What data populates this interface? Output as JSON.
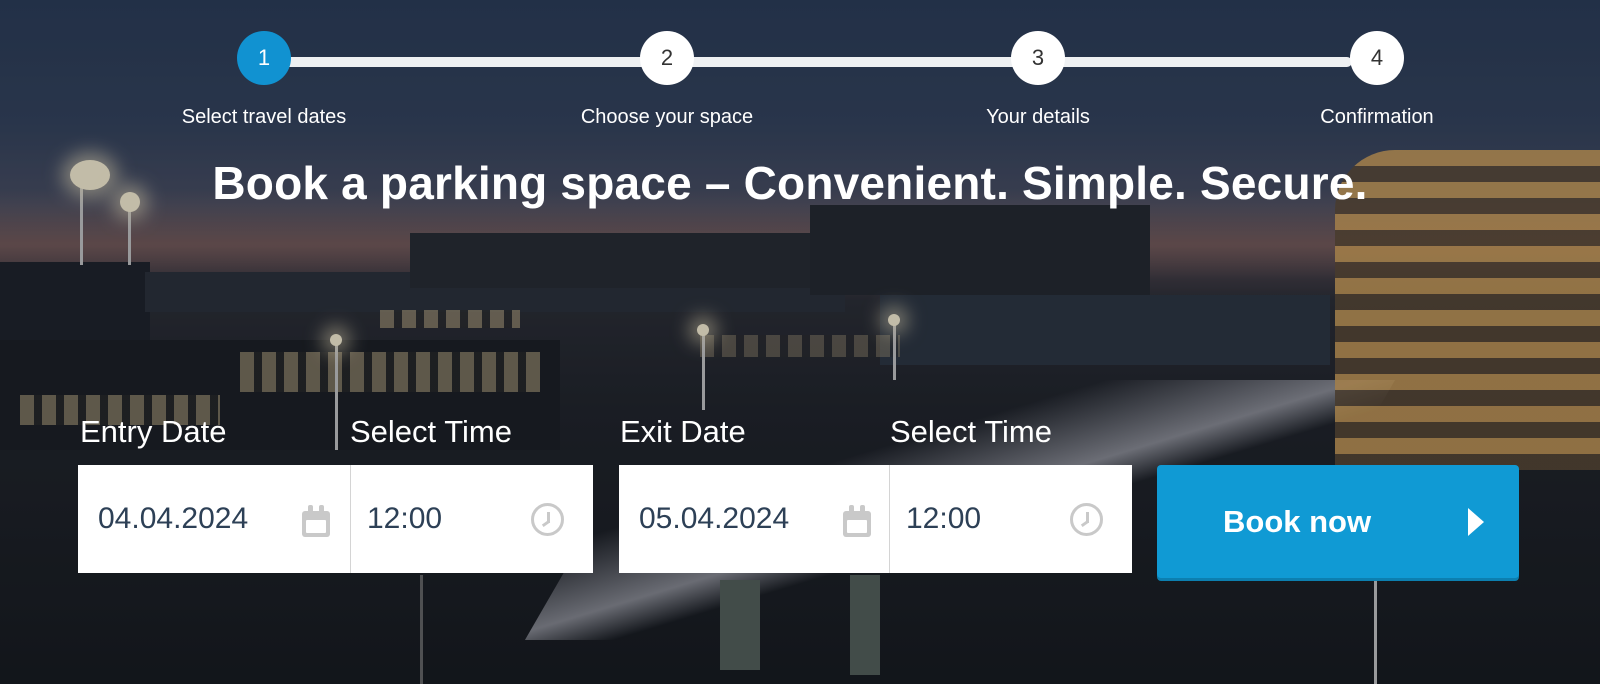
{
  "stepper": {
    "steps": [
      {
        "number": "1",
        "label": "Select travel dates",
        "active": true
      },
      {
        "number": "2",
        "label": "Choose your space",
        "active": false
      },
      {
        "number": "3",
        "label": "Your details",
        "active": false
      },
      {
        "number": "4",
        "label": "Confirmation",
        "active": false
      }
    ]
  },
  "headline": "Book a parking space – Convenient. Simple. Secure.",
  "form": {
    "entry_date": {
      "label": "Entry Date",
      "value": "04.04.2024",
      "icon": "calendar-icon"
    },
    "entry_time": {
      "label": "Select Time",
      "value": "12:00",
      "icon": "clock-icon"
    },
    "exit_date": {
      "label": "Exit Date",
      "value": "05.04.2024",
      "icon": "calendar-icon"
    },
    "exit_time": {
      "label": "Select Time",
      "value": "12:00",
      "icon": "clock-icon"
    },
    "submit": {
      "label": "Book now",
      "icon": "chevron-right-icon"
    }
  },
  "colors": {
    "accent": "#1192d1",
    "button": "#109ad4",
    "input_text": "#2d4056",
    "icon_gray": "#c9c9c9"
  }
}
